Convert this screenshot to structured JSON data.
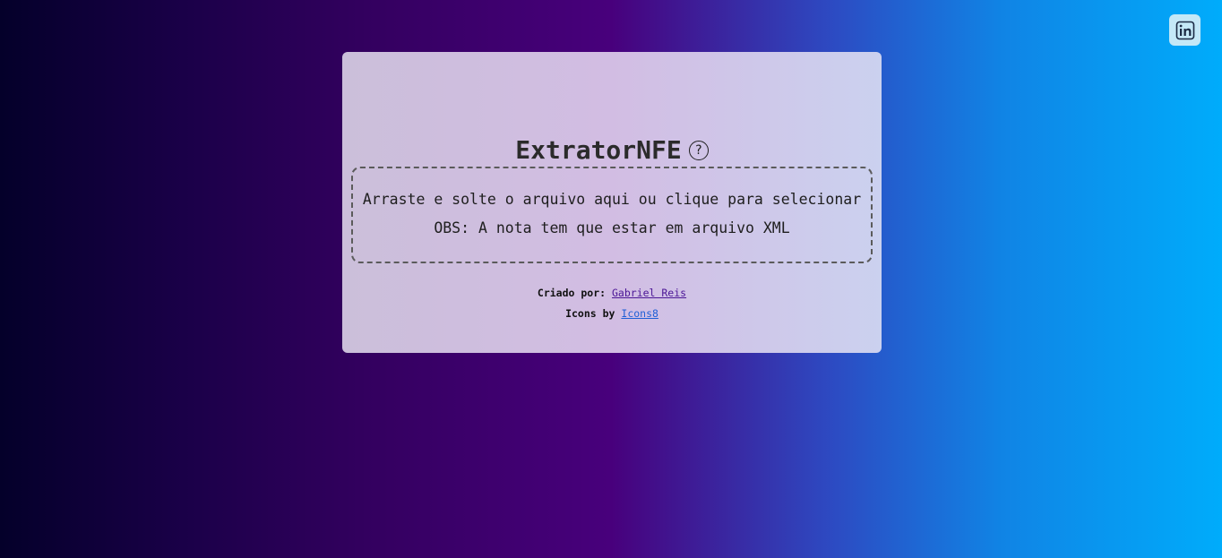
{
  "linkedin": {
    "icon": "linkedin-icon"
  },
  "card": {
    "title": "ExtratorNFE",
    "help_glyph": "?",
    "dropzone": {
      "line1": "Arraste e solte o arquivo aqui ou clique para selecionar",
      "line2": "OBS: A nota tem que estar em arquivo XML"
    },
    "footer": {
      "created_by_label": "Criado por:",
      "author_name": "Gabriel Reis",
      "icons_by_label": "Icons by",
      "icons_provider": "Icons8"
    }
  },
  "colors": {
    "bg_left": "#04002a",
    "bg_mid": "#48007c",
    "bg_right": "#00acfb",
    "author_link": "#4b1696",
    "icons_link": "#1f5fd6"
  }
}
